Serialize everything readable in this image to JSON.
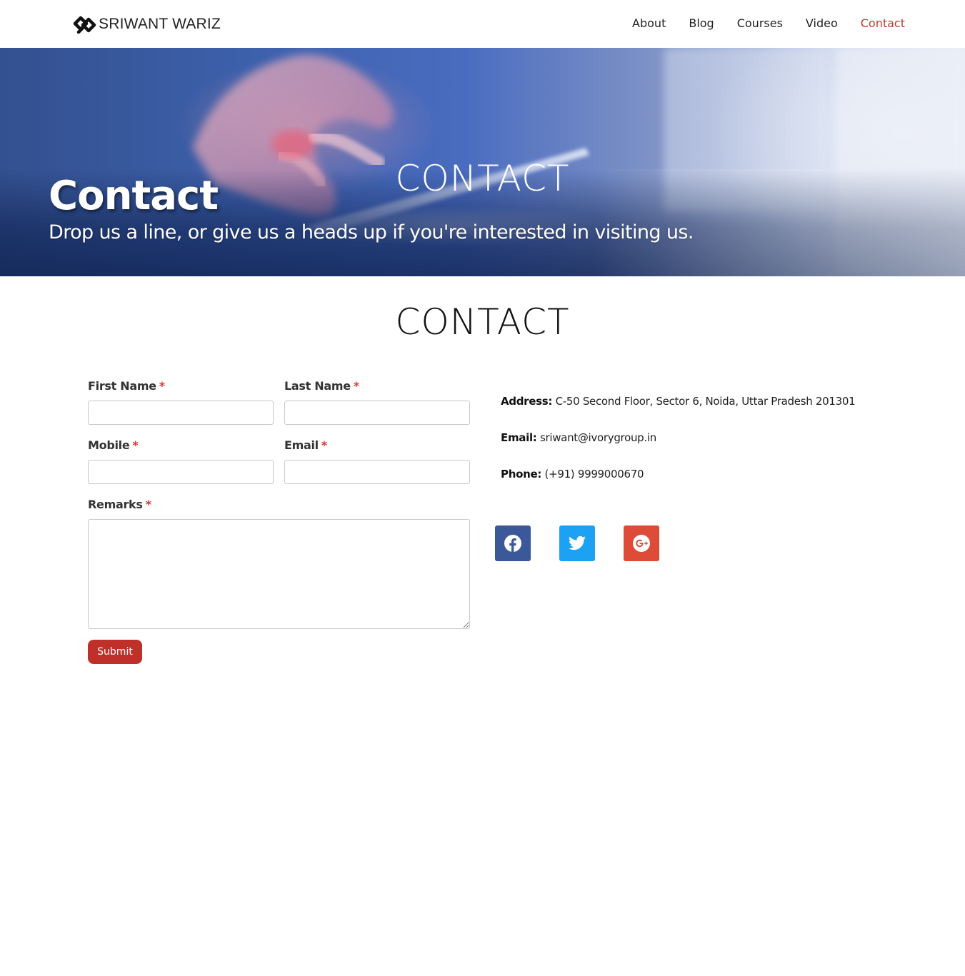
{
  "header": {
    "logo_text": "SRIWANT WARIZ",
    "nav": [
      {
        "label": "About"
      },
      {
        "label": "Blog"
      },
      {
        "label": "Courses"
      },
      {
        "label": "Video"
      },
      {
        "label": "Contact"
      }
    ],
    "active_nav": "Contact",
    "active_color": "#c0392b"
  },
  "hero": {
    "title": "Contact",
    "center_title": "CONTACT",
    "subtitle": "Drop us a line, or give us a heads up if you're interested in visiting us."
  },
  "main": {
    "title": "CONTACT",
    "form": {
      "required_marker": "*",
      "first_name_label": "First Name",
      "last_name_label": "Last Name",
      "mobile_label": "Mobile",
      "email_label": "Email",
      "remarks_label": "Remarks",
      "first_name_value": "",
      "last_name_value": "",
      "mobile_value": "",
      "email_value": "",
      "remarks_value": "",
      "submit_label": "Submit",
      "submit_color": "#c0302a"
    },
    "info": {
      "address_label": "Address:",
      "address_value": "C-50 Second Floor, Sector 6, Noida, Uttar Pradesh 201301",
      "email_label": "Email:",
      "email_value": "sriwant@ivorygroup.in",
      "phone_label": "Phone:",
      "phone_value": "(+91) 9999000670"
    },
    "social": [
      {
        "icon": "facebook-icon",
        "color": "#3b5998"
      },
      {
        "icon": "twitter-icon",
        "color": "#1da1f2"
      },
      {
        "icon": "google-plus-icon",
        "color": "#dd4b39"
      }
    ]
  }
}
